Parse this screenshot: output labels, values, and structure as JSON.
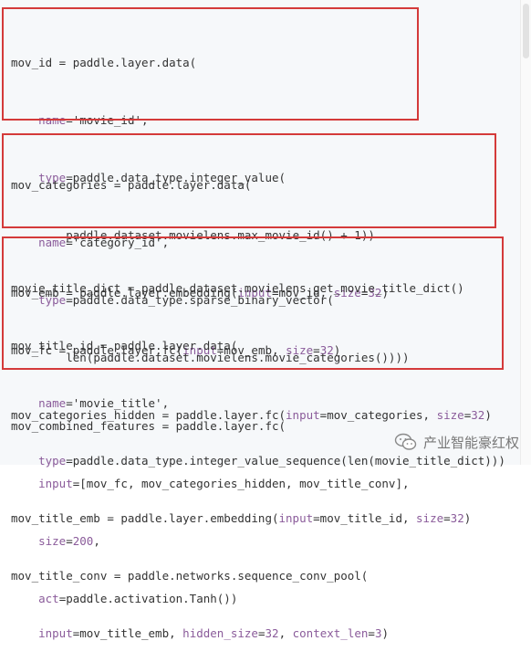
{
  "block1": {
    "l1": "mov_id = paddle.layer.data(",
    "l2_kw": "name",
    "l2_rest": "='movie_id',",
    "l3_kw": "type",
    "l3_rest": "=paddle.data_type.integer_value(",
    "l4": "paddle.dataset.movielens.max_movie_id() + 1))",
    "l5_a": "mov_emb = paddle.layer.embedding(",
    "l5_kw1": "input",
    "l5_b": "=mov_id, ",
    "l5_kw2": "size",
    "l5_c": "=",
    "l5_num": "32",
    "l5_d": ")",
    "l6_a": "mov_fc = paddle.layer.fc(",
    "l6_kw1": "input",
    "l6_b": "=mov_emb, ",
    "l6_kw2": "size",
    "l6_c": "=",
    "l6_num": "32",
    "l6_d": ")"
  },
  "block2": {
    "l1": "mov_categories = paddle.layer.data(",
    "l2_kw": "name",
    "l2_rest": "='category_id',",
    "l3_kw": "type",
    "l3_rest": "=paddle.data_type.sparse_binary_vector(",
    "l4": "len(paddle.dataset.movielens.movie_categories())))",
    "l5_a": "mov_categories_hidden = paddle.layer.fc(",
    "l5_kw1": "input",
    "l5_b": "=mov_categories, ",
    "l5_kw2": "size",
    "l5_c": "=",
    "l5_num": "32",
    "l5_d": ")"
  },
  "block3": {
    "l1": "movie_title_dict = paddle.dataset.movielens.get_movie_title_dict()",
    "l2": "mov_title_id = paddle.layer.data(",
    "l3_kw": "name",
    "l3_rest": "='movie_title',",
    "l4_kw": "type",
    "l4_rest": "=paddle.data_type.integer_value_sequence(len(movie_title_dict)))",
    "l5_a": "mov_title_emb = paddle.layer.embedding(",
    "l5_kw1": "input",
    "l5_b": "=mov_title_id, ",
    "l5_kw2": "size",
    "l5_c": "=",
    "l5_num": "32",
    "l5_d": ")",
    "l6": "mov_title_conv = paddle.networks.sequence_conv_pool(",
    "l7_kw1": "input",
    "l7_a": "=mov_title_emb, ",
    "l7_kw2": "hidden_size",
    "l7_b": "=",
    "l7_num1": "32",
    "l7_c": ", ",
    "l7_kw3": "context_len",
    "l7_d": "=",
    "l7_num2": "3",
    "l7_e": ")"
  },
  "block4": {
    "l1": "mov_combined_features = paddle.layer.fc(",
    "l2_kw": "input",
    "l2_rest": "=[mov_fc, mov_categories_hidden, mov_title_conv],",
    "l3_kw": "size",
    "l3_b": "=",
    "l3_num": "200",
    "l3_c": ",",
    "l4_kw": "act",
    "l4_rest": "=paddle.activation.Tanh())"
  },
  "watermark": {
    "text": "产业智能豪红权",
    "icon": "wechat-icon"
  },
  "colors": {
    "highlight_box": "#d43a3a",
    "keyword": "#8a5b9a",
    "string": "#2f8a6a",
    "background": "#f6f8fa"
  }
}
